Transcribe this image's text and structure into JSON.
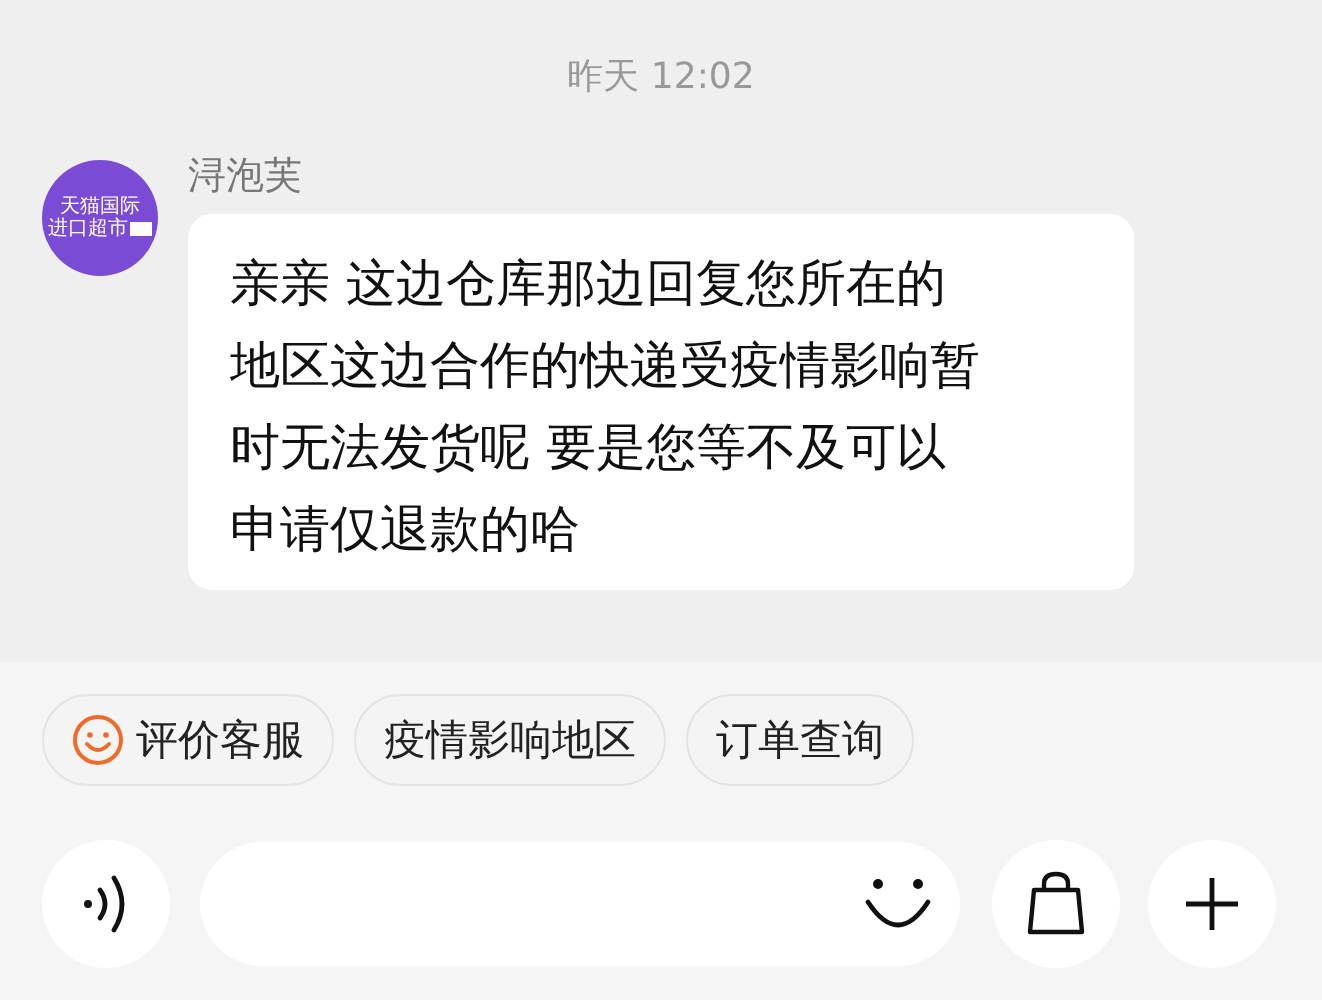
{
  "timestamp": "昨天 12:02",
  "message": {
    "sender": "浔泡芙",
    "avatar_lines": [
      "天猫国际",
      "进口超市"
    ],
    "text": "亲亲 这边仓库那边回复您所在的地区这边合作的快递受疫情影响暂时无法发货呢  要是您等不及可以申请仅退款的哈"
  },
  "quick_replies": [
    {
      "label": "评价客服",
      "kind": "smile"
    },
    {
      "label": "疫情影响地区",
      "kind": "plain"
    },
    {
      "label": "订单查询",
      "kind": "plain"
    }
  ]
}
